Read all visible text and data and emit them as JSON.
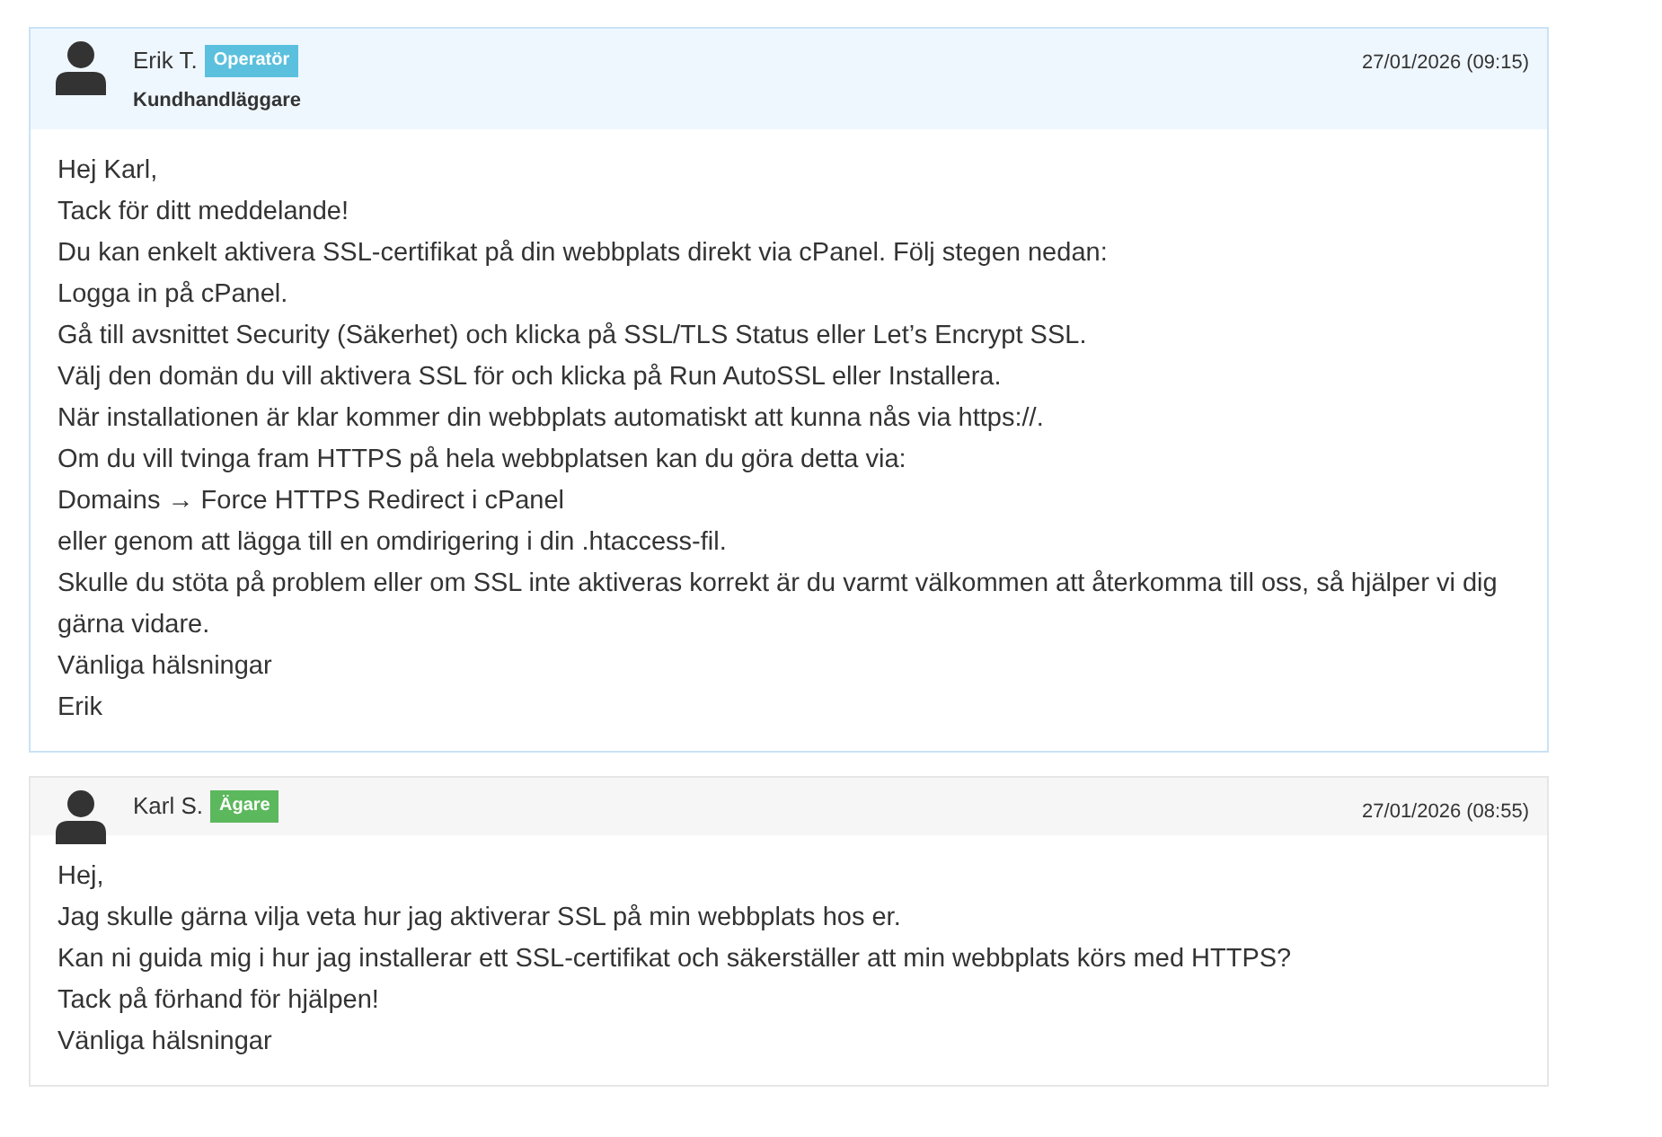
{
  "messages": [
    {
      "kind": "staff",
      "author": "Erik T.",
      "role": "Operatör",
      "title": "Kundhandläggare",
      "date": "27/01/2026 (09:15)",
      "lines": [
        "Hej Karl,",
        "Tack för ditt meddelande!",
        "Du kan enkelt aktivera SSL-certifikat på din webbplats direkt via cPanel. Följ stegen nedan:",
        "Logga in på cPanel.",
        "Gå till avsnittet Security (Säkerhet) och klicka på SSL/TLS Status eller Let’s Encrypt SSL.",
        "Välj den domän du vill aktivera SSL för och klicka på Run AutoSSL eller Installera.",
        "När installationen är klar kommer din webbplats automatiskt att kunna nås via https://.",
        "Om du vill tvinga fram HTTPS på hela webbplatsen kan du göra detta via:",
        "Domains → Force HTTPS Redirect i cPanel",
        "eller genom att lägga till en omdirigering i din .htaccess-fil.",
        "Skulle du stöta på problem eller om SSL inte aktiveras korrekt är du varmt välkommen att återkomma till oss, så hjälper vi dig gärna vidare.",
        "Vänliga hälsningar",
        "Erik"
      ]
    },
    {
      "kind": "client",
      "author": "Karl S.",
      "role": "Ägare",
      "date": "27/01/2026 (08:55)",
      "lines": [
        "Hej,",
        "Jag skulle gärna vilja veta hur jag aktiverar SSL på min webbplats hos er.",
        "Kan ni guida mig i hur jag installerar ett SSL-certifikat och säkerställer att min webbplats körs med HTTPS?",
        "Tack på förhand för hjälpen!",
        "Vänliga hälsningar"
      ]
    }
  ]
}
